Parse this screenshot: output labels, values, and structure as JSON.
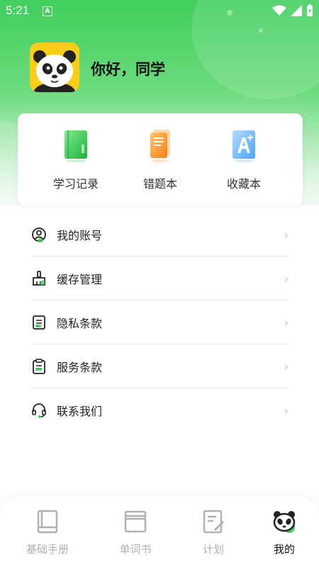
{
  "status_bar": {
    "time": "5:21",
    "badge": "A"
  },
  "profile": {
    "greeting": "你好，同学"
  },
  "quick_actions": [
    {
      "label": "学习记录",
      "icon": "green-book-icon"
    },
    {
      "label": "错题本",
      "icon": "orange-notebook-icon"
    },
    {
      "label": "收藏本",
      "icon": "blue-a-plus-icon"
    }
  ],
  "menu": [
    {
      "label": "我的账号",
      "icon": "user-circle-icon"
    },
    {
      "label": "缓存管理",
      "icon": "broom-icon"
    },
    {
      "label": "隐私条款",
      "icon": "document-icon"
    },
    {
      "label": "服务条款",
      "icon": "clipboard-icon"
    },
    {
      "label": "联系我们",
      "icon": "headset-icon"
    }
  ],
  "tabs": [
    {
      "label": "基础手册",
      "icon": "manual-icon",
      "active": false
    },
    {
      "label": "单词书",
      "icon": "book-icon",
      "active": false
    },
    {
      "label": "计划",
      "icon": "plan-icon",
      "active": false
    },
    {
      "label": "我的",
      "icon": "panda-icon",
      "active": true
    }
  ],
  "colors": {
    "brand_green": "#3fcf5c",
    "inactive_tab": "#b0b0b0"
  }
}
